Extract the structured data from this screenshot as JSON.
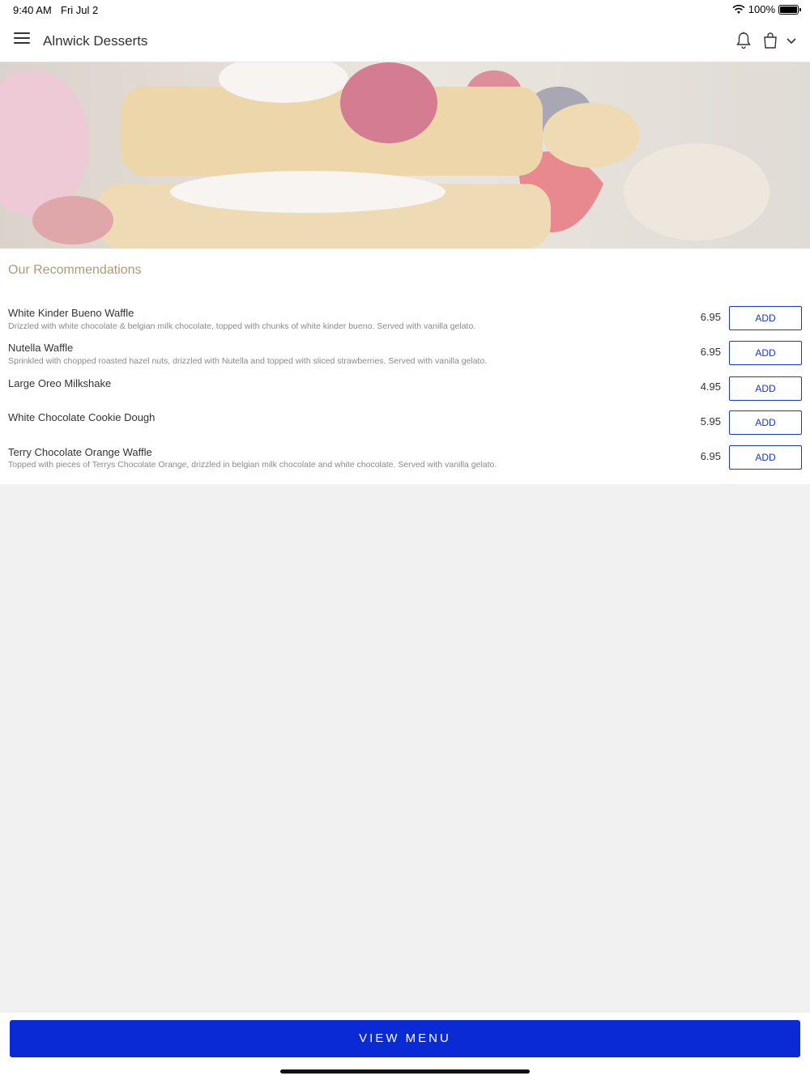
{
  "status_bar": {
    "time": "9:40 AM",
    "date": "Fri Jul 2",
    "battery": "100%",
    "battery_level": 1.0
  },
  "header": {
    "title": "Alnwick Desserts",
    "icons": [
      "menu-icon",
      "bell-icon",
      "bag-icon",
      "chevron-down-icon"
    ]
  },
  "recommendations": {
    "title": "Our Recommendations",
    "items": [
      {
        "name": "White Kinder Bueno Waffle",
        "description": "Drizzled with white chocolate & belgian milk chocolate, topped with chunks of white kinder bueno. Served with vanilla gelato.",
        "price": "6.95",
        "button": "ADD"
      },
      {
        "name": "Nutella Waffle",
        "description": "Sprinkled with chopped roasted hazel nuts, drizzled with Nutella and topped with sliced strawberries. Served with vanilla gelato.",
        "price": "6.95",
        "button": "ADD"
      },
      {
        "name": "Large Oreo Milkshake",
        "description": "",
        "price": "4.95",
        "button": "ADD"
      },
      {
        "name": "White Chocolate Cookie Dough",
        "description": "",
        "price": "5.95",
        "button": "ADD"
      },
      {
        "name": "Terry Chocolate Orange Waffle",
        "description": "Topped with pieces of Terrys Chocolate Orange, drizzled in belgian milk chocolate and white chocolate. Served with vanilla gelato.",
        "price": "6.95",
        "button": "ADD"
      }
    ]
  },
  "footer": {
    "view_menu": "VIEW MENU"
  },
  "colors": {
    "accent": "#0a2ad6",
    "section_title": "#b09a74",
    "background": "#f1f1f1"
  }
}
